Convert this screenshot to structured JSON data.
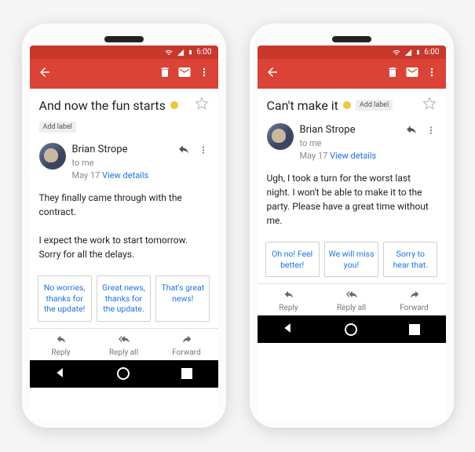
{
  "status": {
    "time": "6:00"
  },
  "phones": [
    {
      "subject": "And now the fun starts",
      "add_label": "Add label",
      "sender": {
        "name": "Brian Strope",
        "to": "to me",
        "date": "May 17",
        "view_details": "View details"
      },
      "body": "They finally came through with the contract.\n\nI expect the work to start tomorrow. Sorry for all the delays.",
      "smart_replies": [
        "No worries, thanks for the update!",
        "Great news, thanks for the update.",
        "That's great news!"
      ],
      "actions": {
        "reply": "Reply",
        "reply_all": "Reply all",
        "forward": "Forward"
      }
    },
    {
      "subject": "Can't make it",
      "add_label": "Add label",
      "sender": {
        "name": "Brian Strope",
        "to": "to me",
        "date": "May 17",
        "view_details": "View details"
      },
      "body": "Ugh, I took a turn for the worst last night. I won't be able to make it to the party. Please have a great time without me.",
      "smart_replies": [
        "Oh no! Feel better!",
        "We will miss you!",
        "Sorry to hear that."
      ],
      "actions": {
        "reply": "Reply",
        "reply_all": "Reply all",
        "forward": "Forward"
      }
    }
  ]
}
